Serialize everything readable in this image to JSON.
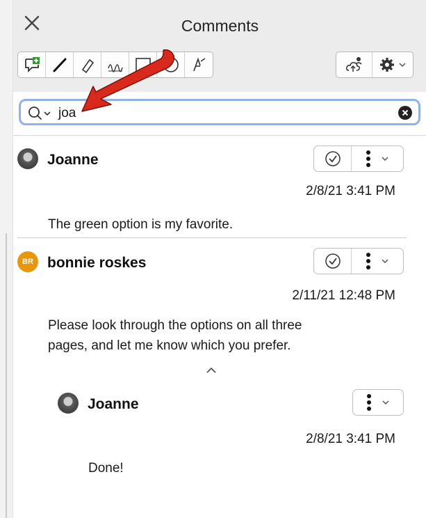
{
  "panel": {
    "title": "Comments"
  },
  "search": {
    "value": "joa"
  },
  "comments": [
    {
      "author": "Joanne",
      "datetime": "2/8/21 3:41 PM",
      "text": "The green option is my favorite."
    },
    {
      "author": "bonnie roskes",
      "initials": "BR",
      "datetime": "2/11/21 12:48 PM",
      "text_line1": "Please look through the options on all three",
      "text_line2": "pages, and let me know which you prefer.",
      "reply": {
        "author": "Joanne",
        "datetime": "2/8/21 3:41 PM",
        "text": "Done!"
      }
    }
  ],
  "colors": {
    "accent_focus": "#8fb1ee",
    "avatar_br": "#e8960c",
    "callout_arrow": "#d9281c",
    "add_comment_green": "#2aa02a"
  },
  "icons": [
    "close-icon",
    "add-comment-icon",
    "pen-icon",
    "highlighter-icon",
    "signature-icon",
    "rectangle-icon",
    "ellipse-icon",
    "text-tool-icon",
    "share-cloud-icon",
    "gear-icon",
    "search-icon",
    "clear-icon",
    "resolve-check-icon",
    "more-options-icon",
    "chevron-down-icon",
    "collapse-chevron-up-icon"
  ]
}
